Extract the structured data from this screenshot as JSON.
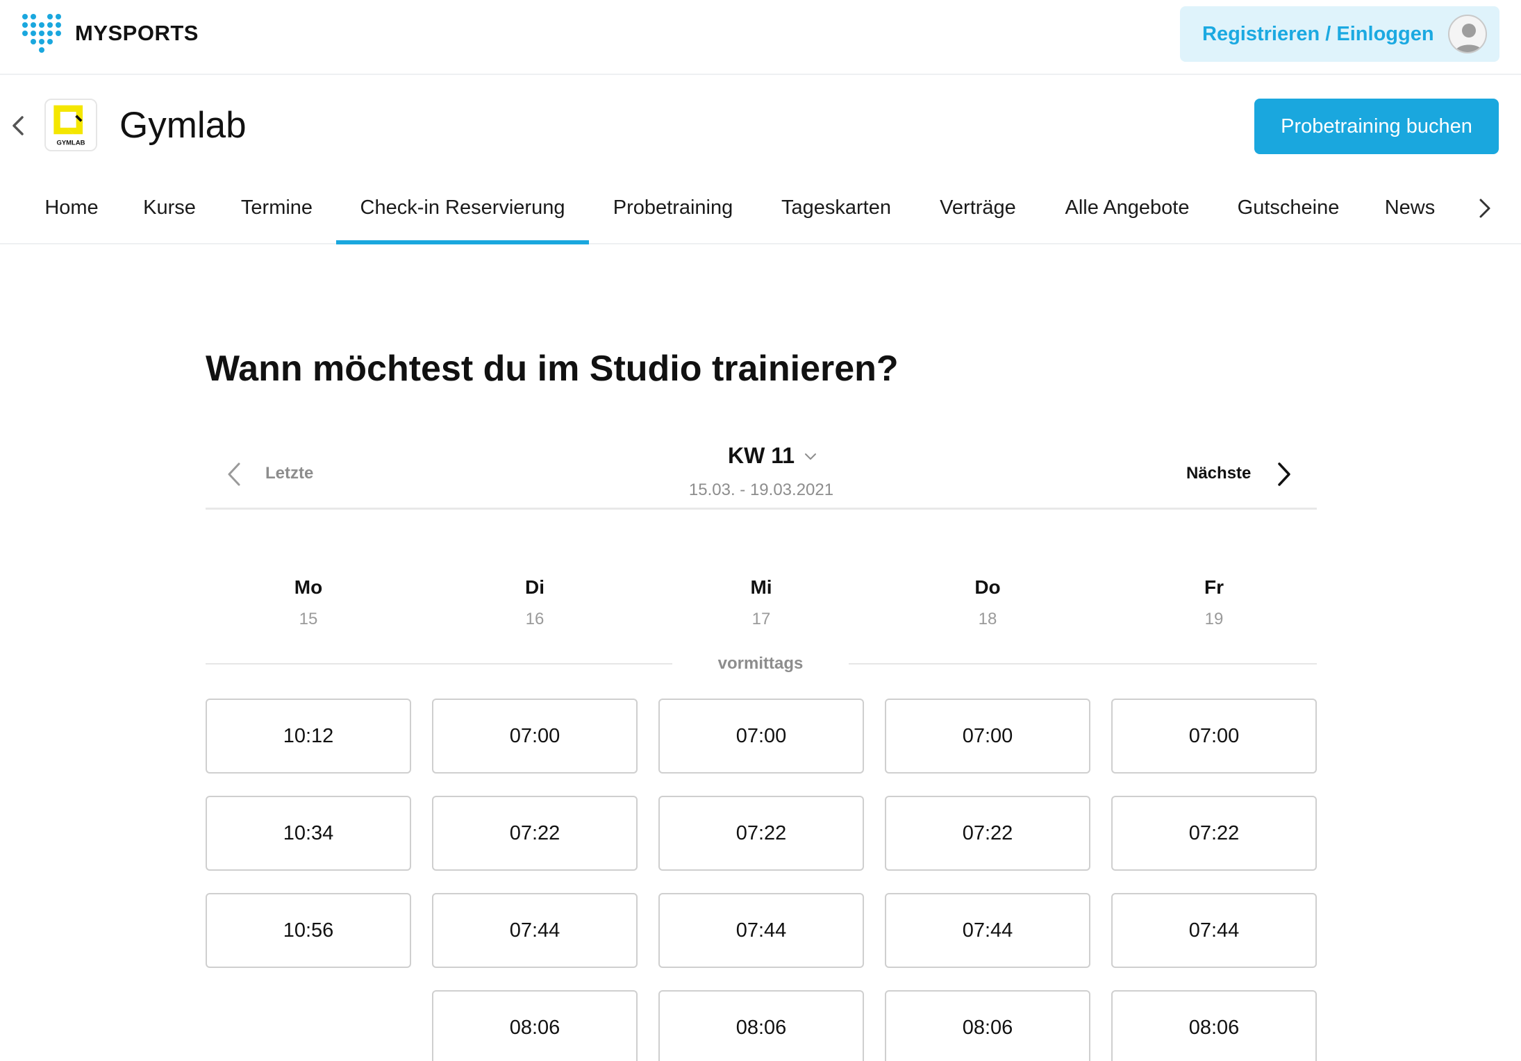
{
  "app": {
    "brand": "MYSPORTS",
    "login_label": "Registrieren / Einloggen"
  },
  "studio": {
    "name": "Gymlab",
    "logo_text": "GYMLAB",
    "trial_button": "Probetraining buchen"
  },
  "nav": {
    "tabs": [
      {
        "label": "Home"
      },
      {
        "label": "Kurse"
      },
      {
        "label": "Termine"
      },
      {
        "label": "Check-in Reservierung",
        "active": true
      },
      {
        "label": "Probetraining"
      },
      {
        "label": "Tageskarten"
      },
      {
        "label": "Verträge"
      },
      {
        "label": "Alle Angebote"
      },
      {
        "label": "Gutscheine"
      },
      {
        "label": "News"
      }
    ]
  },
  "main": {
    "heading": "Wann möchtest du im Studio trainieren?",
    "week": {
      "prev_label": "Letzte",
      "title": "KW 11",
      "range": "15.03. - 19.03.2021",
      "next_label": "Nächste"
    },
    "section_label": "vormittags",
    "days": [
      {
        "name": "Mo",
        "date": "15",
        "slots": [
          "10:12",
          "10:34",
          "10:56"
        ]
      },
      {
        "name": "Di",
        "date": "16",
        "slots": [
          "07:00",
          "07:22",
          "07:44",
          "08:06"
        ]
      },
      {
        "name": "Mi",
        "date": "17",
        "slots": [
          "07:00",
          "07:22",
          "07:44",
          "08:06"
        ]
      },
      {
        "name": "Do",
        "date": "18",
        "slots": [
          "07:00",
          "07:22",
          "07:44",
          "08:06"
        ]
      },
      {
        "name": "Fr",
        "date": "19",
        "slots": [
          "07:00",
          "07:22",
          "07:44",
          "08:06"
        ]
      }
    ]
  },
  "colors": {
    "accent": "#1aa7de",
    "login_bg": "#dff3fb",
    "logo_yellow": "#f4e600"
  },
  "icons": [
    "mysports-logo-icon",
    "avatar-icon",
    "back-arrow-icon",
    "nav-next-icon",
    "chevron-left-icon",
    "chevron-down-icon",
    "chevron-right-icon"
  ]
}
